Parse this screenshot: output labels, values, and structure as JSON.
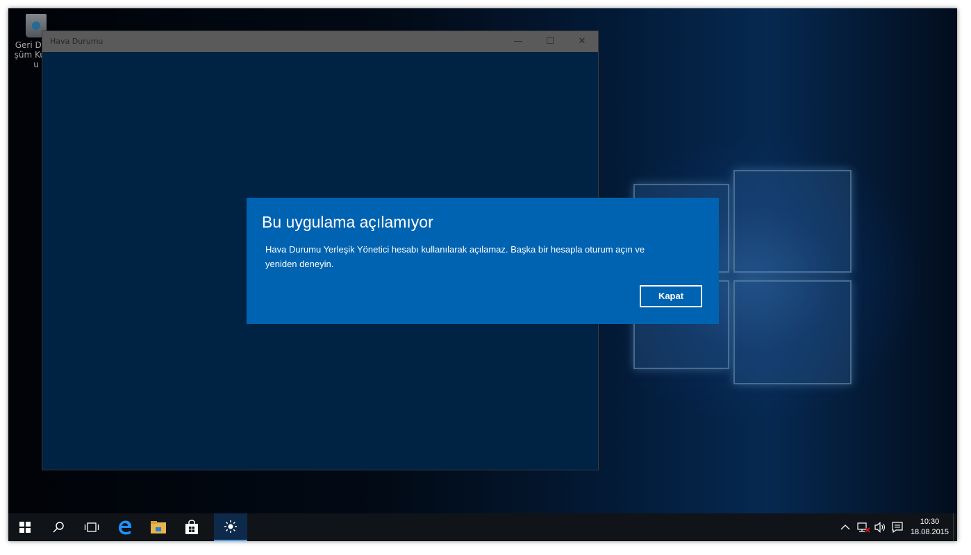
{
  "desktop": {
    "icons": [
      {
        "label": "Geri Dönüşüm Kutusu",
        "icon": "recycle-bin-icon"
      }
    ]
  },
  "window": {
    "title": "Hava Durumu",
    "controls": {
      "minimize": "—",
      "maximize": "☐",
      "close": "✕"
    }
  },
  "dialog": {
    "title": "Bu uygulama açılamıyor",
    "message": "Hava Durumu Yerleşik Yönetici hesabı kullanılarak açılamaz. Başka bir hesapla oturum açın ve yeniden deneyin.",
    "button": "Kapat"
  },
  "taskbar": {
    "items": [
      {
        "name": "start-button",
        "icon": "windows-icon"
      },
      {
        "name": "search-button",
        "icon": "search-icon"
      },
      {
        "name": "task-view-button",
        "icon": "task-view-icon"
      },
      {
        "name": "edge-button",
        "icon": "edge-icon"
      },
      {
        "name": "file-explorer-button",
        "icon": "folder-icon"
      },
      {
        "name": "store-button",
        "icon": "store-icon"
      },
      {
        "name": "weather-app-button",
        "icon": "sun-icon",
        "active": true
      }
    ],
    "tray": {
      "chevron": "^",
      "time": "10:30",
      "date": "18.08.2015"
    }
  },
  "colors": {
    "dialog": "#0063b1",
    "app_background": "#003768",
    "taskbar": "#101419"
  }
}
